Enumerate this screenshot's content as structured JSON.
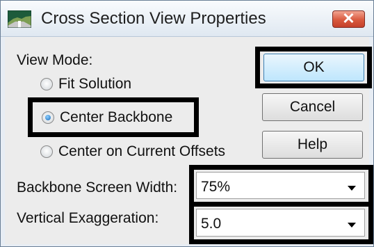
{
  "window": {
    "title": "Cross Section View Properties",
    "close_label": "✕",
    "app_icon": "cross-section-app-icon"
  },
  "view_mode": {
    "label": "View Mode:",
    "options": [
      {
        "label": "Fit Solution",
        "selected": false
      },
      {
        "label": "Center Backbone",
        "selected": true
      },
      {
        "label": "Center on Current Offsets",
        "selected": false
      }
    ]
  },
  "buttons": {
    "ok": "OK",
    "cancel": "Cancel",
    "help": "Help"
  },
  "fields": {
    "backbone_screen_width": {
      "label": "Backbone Screen Width:",
      "value": "75%"
    },
    "vertical_exaggeration": {
      "label": "Vertical Exaggeration:",
      "value": "5.0"
    }
  },
  "colors": {
    "highlight_border": "#000000",
    "close_button": "#d9593e",
    "default_button": "#bee6fd"
  },
  "icons": [
    "cross-section-app-icon",
    "close-icon",
    "chevron-down-icon",
    "radio-selected-icon",
    "radio-unselected-icon"
  ]
}
